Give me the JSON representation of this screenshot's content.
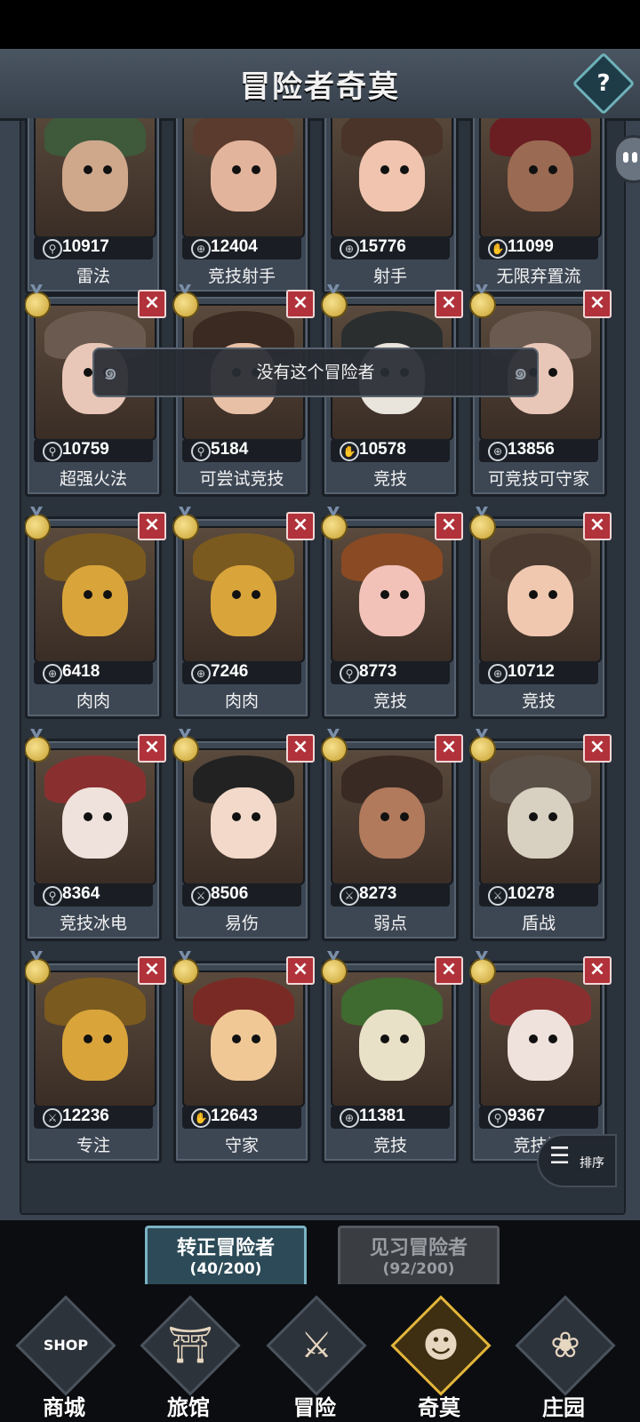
{
  "header": {
    "title": "冒险者奇莫",
    "help_label": "?"
  },
  "toast": "没有这个冒险者",
  "sort": {
    "label": "排序"
  },
  "colors": {
    "accent": "#7ab3c4",
    "close": "#b1323a",
    "medal": "#e3b53a"
  },
  "cards": [
    {
      "value": "10917",
      "label": "雷法",
      "icon": "staff-icon"
    },
    {
      "value": "12404",
      "label": "竞技射手",
      "icon": "crosshair-icon"
    },
    {
      "value": "15776",
      "label": "射手",
      "icon": "crosshair-icon"
    },
    {
      "value": "11099",
      "label": "无限弃置流",
      "icon": "claw-icon"
    },
    {
      "value": "10759",
      "label": "超强火法",
      "icon": "staff-icon"
    },
    {
      "value": "5184",
      "label": "可尝试竞技",
      "icon": "staff-icon"
    },
    {
      "value": "10578",
      "label": "竞技",
      "icon": "claw-icon"
    },
    {
      "value": "13856",
      "label": "可竞技可守家",
      "icon": "crosshair-icon"
    },
    {
      "value": "6418",
      "label": "肉肉",
      "icon": "crosshair-icon"
    },
    {
      "value": "7246",
      "label": "肉肉",
      "icon": "crosshair-icon"
    },
    {
      "value": "8773",
      "label": "竞技",
      "icon": "staff-icon"
    },
    {
      "value": "10712",
      "label": "竞技",
      "icon": "crosshair-icon"
    },
    {
      "value": "8364",
      "label": "竞技冰电",
      "icon": "staff-icon"
    },
    {
      "value": "8506",
      "label": "易伤",
      "icon": "sword-icon"
    },
    {
      "value": "8273",
      "label": "弱点",
      "icon": "sword-icon"
    },
    {
      "value": "10278",
      "label": "盾战",
      "icon": "sword-icon"
    },
    {
      "value": "12236",
      "label": "专注",
      "icon": "sword-icon"
    },
    {
      "value": "12643",
      "label": "守家",
      "icon": "claw-icon"
    },
    {
      "value": "11381",
      "label": "竞技",
      "icon": "crosshair-icon"
    },
    {
      "value": "9367",
      "label": "竞技法",
      "icon": "staff-icon"
    }
  ],
  "tabs": [
    {
      "label": "转正冒险者",
      "count": "(40/200)"
    },
    {
      "label": "见习冒险者",
      "count": "(92/200)"
    }
  ],
  "nav": [
    {
      "label": "商城",
      "icon": "shop-icon",
      "badge": "SHOP"
    },
    {
      "label": "旅馆",
      "icon": "inn-gate-icon"
    },
    {
      "label": "冒险",
      "icon": "crossed-swords-icon"
    },
    {
      "label": "奇莫",
      "icon": "chimo-character-icon"
    },
    {
      "label": "庄园",
      "icon": "manor-island-icon"
    }
  ]
}
